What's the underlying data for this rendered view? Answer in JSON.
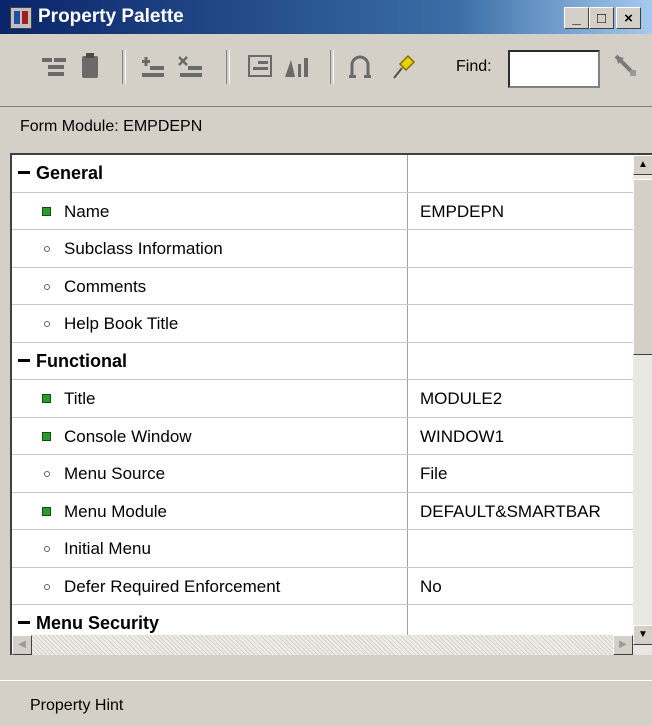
{
  "window": {
    "title": "Property Palette",
    "minimize_label": "_",
    "maximize_label": "□",
    "close_label": "×"
  },
  "toolbar": {
    "find_label": "Find:",
    "find_value": "",
    "icons": [
      "expand-all-icon",
      "collapse-icon",
      "add-property-icon",
      "delete-property-icon",
      "inherit-icon",
      "localize-icon",
      "intersection-icon",
      "pin-icon",
      "find-icon"
    ]
  },
  "context": {
    "label": "Form Module: EMPDEPN"
  },
  "rows": [
    {
      "type": "group",
      "label": "General",
      "value": ""
    },
    {
      "type": "property",
      "label": "Name",
      "value": "EMPDEPN",
      "marker": "set"
    },
    {
      "type": "property",
      "label": "Subclass Information",
      "value": "",
      "marker": "default"
    },
    {
      "type": "property",
      "label": "Comments",
      "value": "",
      "marker": "default"
    },
    {
      "type": "property",
      "label": "Help Book Title",
      "value": "",
      "marker": "default"
    },
    {
      "type": "group",
      "label": "Functional",
      "value": ""
    },
    {
      "type": "property",
      "label": "Title",
      "value": "MODULE2",
      "marker": "set"
    },
    {
      "type": "property",
      "label": "Console Window",
      "value": "WINDOW1",
      "marker": "set"
    },
    {
      "type": "property",
      "label": "Menu Source",
      "value": "File",
      "marker": "default"
    },
    {
      "type": "property",
      "label": "Menu Module",
      "value": "DEFAULT&SMARTBAR",
      "marker": "set"
    },
    {
      "type": "property",
      "label": "Initial Menu",
      "value": "",
      "marker": "default"
    },
    {
      "type": "property",
      "label": "Defer Required Enforcement",
      "value": "No",
      "marker": "default"
    },
    {
      "type": "group",
      "label": "Menu Security",
      "value": ""
    }
  ],
  "scroll": {
    "up_arrow": "▲",
    "down_arrow": "▼",
    "left_arrow": "◀",
    "right_arrow": "▶"
  },
  "status": {
    "hint": "Property Hint"
  }
}
